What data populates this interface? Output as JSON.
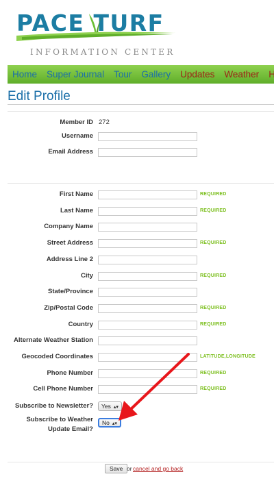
{
  "logo": {
    "main": "PACE TURF",
    "sub": "INFORMATION CENTER"
  },
  "nav": {
    "items": [
      "Home",
      "Super Journal",
      "Tour",
      "Gallery",
      "Updates",
      "Weather",
      "Highlights"
    ]
  },
  "page": {
    "title": "Edit Profile"
  },
  "account": {
    "member_id_label": "Member ID",
    "member_id_value": "272",
    "username_label": "Username",
    "username_value": "",
    "email_label": "Email Address",
    "email_value": ""
  },
  "profile": {
    "first_name": {
      "label": "First Name",
      "value": "",
      "note": "REQUIRED"
    },
    "last_name": {
      "label": "Last Name",
      "value": "",
      "note": "REQUIRED"
    },
    "company_name": {
      "label": "Company Name",
      "value": ""
    },
    "street_address": {
      "label": "Street Address",
      "value": "",
      "note": "REQUIRED"
    },
    "address_line_2": {
      "label": "Address Line 2",
      "value": ""
    },
    "city": {
      "label": "City",
      "value": "",
      "note": "REQUIRED"
    },
    "state": {
      "label": "State/Province",
      "value": ""
    },
    "zip": {
      "label": "Zip/Postal Code",
      "value": "",
      "note": "REQUIRED"
    },
    "country": {
      "label": "Country",
      "value": "",
      "note": "REQUIRED"
    },
    "alt_weather": {
      "label": "Alternate Weather Station",
      "value": ""
    },
    "geocoded": {
      "label": "Geocoded Coordinates",
      "value": "",
      "note": "LATITUDE,LONGITUDE"
    },
    "phone": {
      "label": "Phone Number",
      "value": "",
      "note": "REQUIRED"
    },
    "cell_phone": {
      "label": "Cell Phone Number",
      "value": "",
      "note": "REQUIRED"
    },
    "newsletter": {
      "label": "Subscribe to Newsletter?",
      "value": "Yes"
    },
    "weather_email": {
      "label_line1": "Subscribe to Weather",
      "label_line2": "Update Email?",
      "value": "No"
    }
  },
  "footer": {
    "save_label": "Save",
    "or_text": "or",
    "cancel_label": "cancel and go back"
  },
  "colors": {
    "brand_blue": "#1b6fa8",
    "nav_green": "#6cbf35",
    "alt_nav_red": "#9c2416",
    "required_green": "#7cbf1e",
    "annotation_arrow": "#e8161b"
  }
}
